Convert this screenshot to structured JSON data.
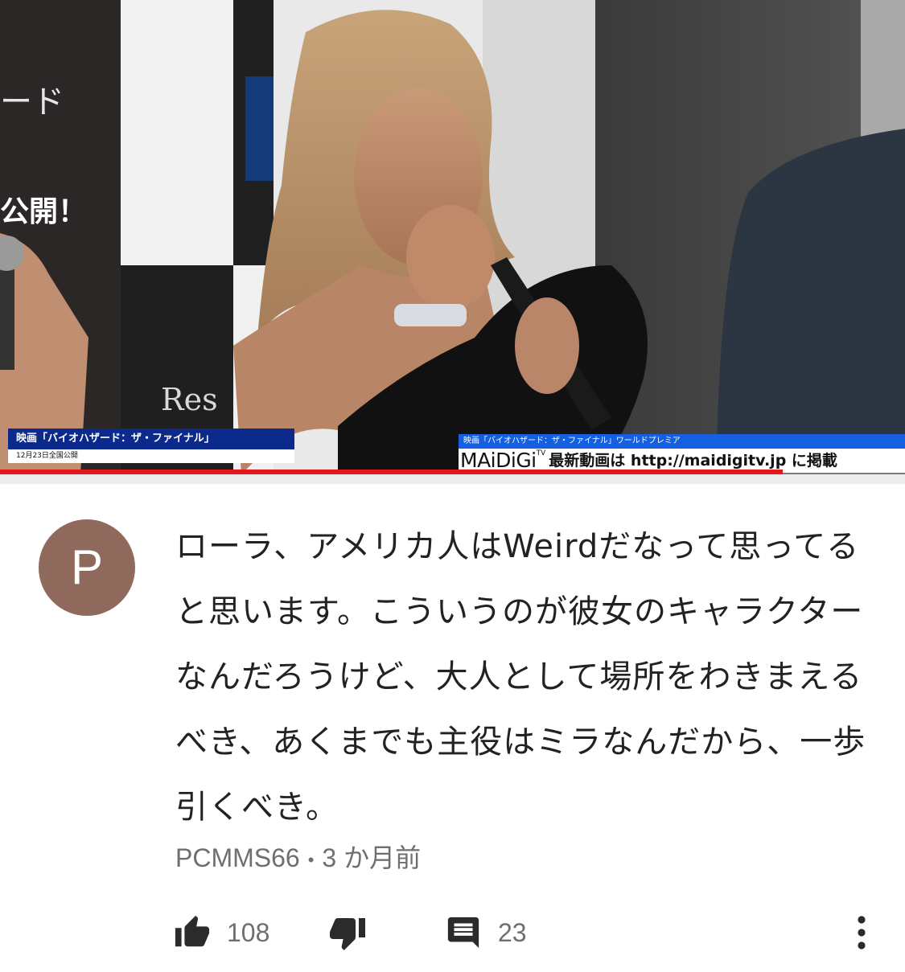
{
  "video": {
    "caption_left_title": "映画「バイオハザード：ザ・ファイナル」",
    "caption_left_sub": "12月23日全国公開",
    "caption_right_title": "映画「バイオハザード：ザ・ファイナル」ワールドプレミア",
    "logo_text": "MAiDiGi",
    "logo_tv": "TV",
    "caption_url": "最新動画は http://maidigitv.jp に掲載",
    "backdrop_text_1": "ード",
    "backdrop_text_2": "公開！",
    "backdrop_text_3": "Res",
    "progress_fraction": 0.865,
    "progress_color": "#e3171e"
  },
  "comment": {
    "avatar_letter": "P",
    "avatar_color": "#8f6a5c",
    "text": "ローラ、アメリカ人はWeirdだなって思ってると思います。こういうのが彼女のキャラクターなんだろうけど、大人として場所をわきまえるべき、あくまでも主役はミラなんだから、一歩引くべき。",
    "author": "PCMMS66",
    "separator": "•",
    "time": "3 か月前"
  },
  "actions": {
    "like_icon": "thumb-up-icon",
    "like_count": "108",
    "dislike_icon": "thumb-down-icon",
    "reply_icon": "comment-icon",
    "reply_count": "23",
    "more_icon": "more-vert-icon"
  }
}
